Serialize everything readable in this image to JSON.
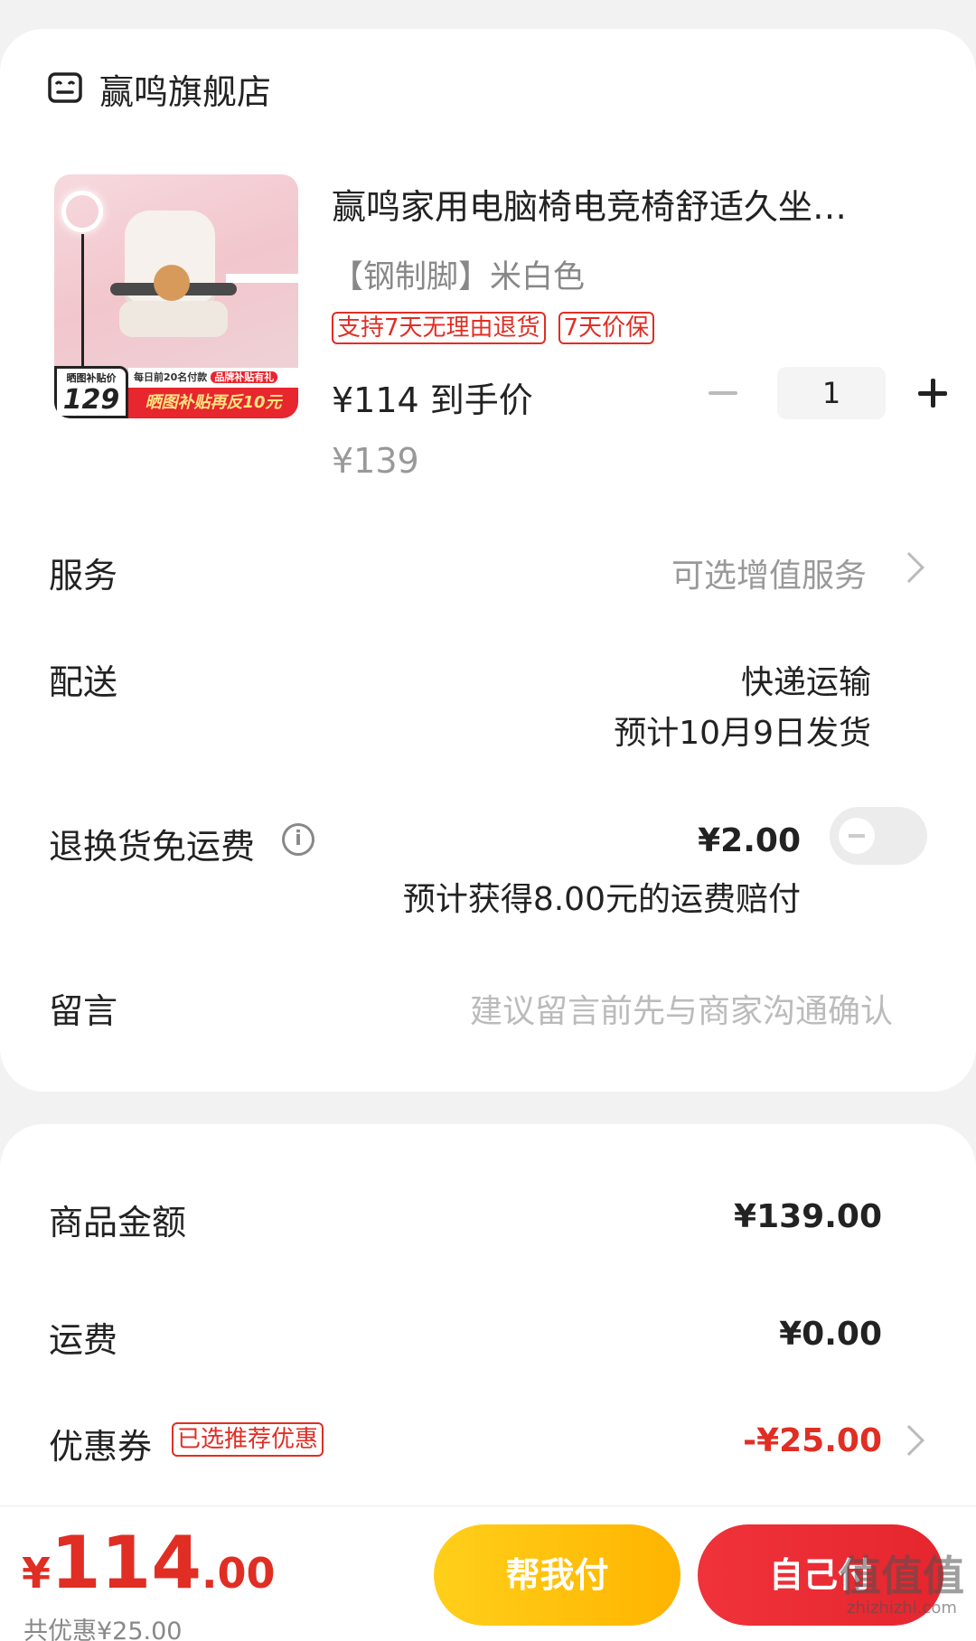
{
  "shop": {
    "name": "赢鸣旗舰店"
  },
  "product": {
    "title": "赢鸣家用电脑椅电竞椅舒适久坐…",
    "spec": "【钢制脚】米白色",
    "tags": [
      "支持7天无理由退货",
      "7天价保"
    ],
    "final_price": "¥114 到手价",
    "original_price": "¥139",
    "quantity": "1",
    "image": {
      "promo_small": "晒图补贴价",
      "promo_number": "129",
      "promo_top": "每日前20名付款",
      "promo_top_badge": "品牌补贴有礼",
      "promo_main": "晒图补贴再反10元"
    }
  },
  "rows": {
    "service": {
      "label": "服务",
      "value": "可选增值服务"
    },
    "delivery": {
      "label": "配送",
      "method": "快递运输",
      "eta": "预计10月9日发货"
    },
    "return_shipping": {
      "label": "退换货免运费",
      "price": "¥2.00",
      "note": "预计获得8.00元的运费赔付",
      "enabled": false
    },
    "message": {
      "label": "留言",
      "placeholder": "建议留言前先与商家沟通确认"
    }
  },
  "summary": {
    "goods_amount": {
      "label": "商品金额",
      "value": "¥139.00"
    },
    "shipping": {
      "label": "运费",
      "value": "¥0.00"
    },
    "coupon": {
      "label": "优惠券",
      "tag": "已选推荐优惠",
      "value": "-¥25.00"
    }
  },
  "bottom": {
    "currency": "¥",
    "total_int": "114",
    "total_dec": ".00",
    "saved": "共优惠¥25.00",
    "help_pay": "帮我付",
    "self_pay": "自己付"
  },
  "watermark": {
    "line1": "值值值",
    "line2": "zhizhizhi.com"
  },
  "colors": {
    "accent_red": "#e02e24",
    "help_yellow": "#ffc20e",
    "pay_red": "#e8262e"
  }
}
